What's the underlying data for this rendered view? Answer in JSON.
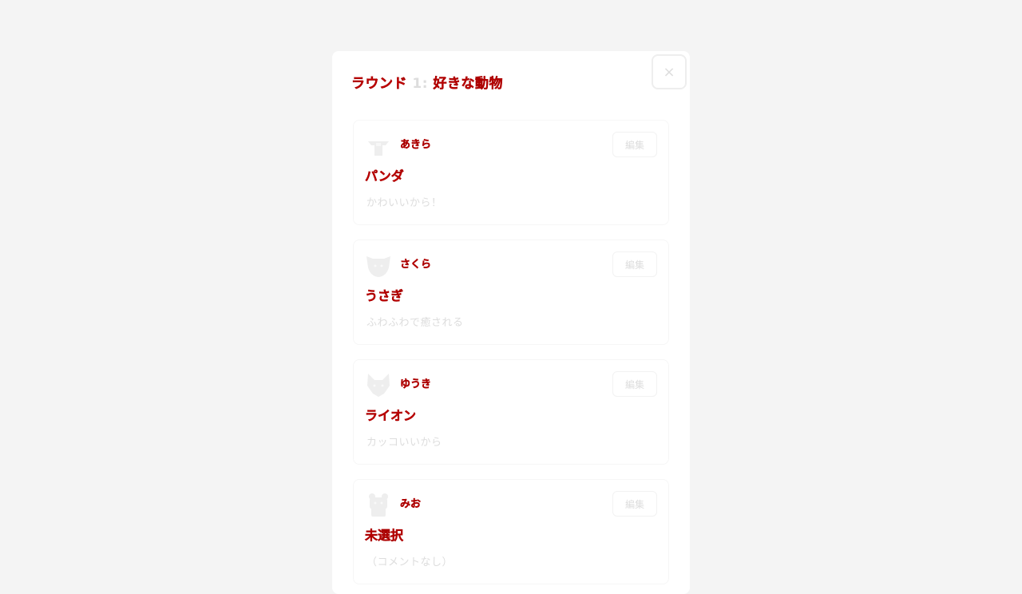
{
  "modal": {
    "title_prefix": "ラウンド",
    "title_round": "1:",
    "title_topic": "好きな動物",
    "close_label": "×"
  },
  "edit_label": "編集",
  "answers": [
    {
      "player": "あきら",
      "answer": "パンダ",
      "comment": "かわいいから！",
      "avatar_icon": "cat-avatar-icon"
    },
    {
      "player": "さくら",
      "answer": "うさぎ",
      "comment": "ふわふわで癒される",
      "avatar_icon": "dog-avatar-icon"
    },
    {
      "player": "ゆうき",
      "answer": "ライオン",
      "comment": "カッコいいから",
      "avatar_icon": "fox-avatar-icon"
    },
    {
      "player": "みお",
      "answer": "未選択",
      "comment": "（コメントなし）",
      "avatar_icon": "bear-avatar-icon"
    }
  ],
  "colors": {
    "accent": "#ee0000",
    "muted": "#dddddd",
    "background": "#f4f4f4",
    "panel": "#ffffff"
  }
}
